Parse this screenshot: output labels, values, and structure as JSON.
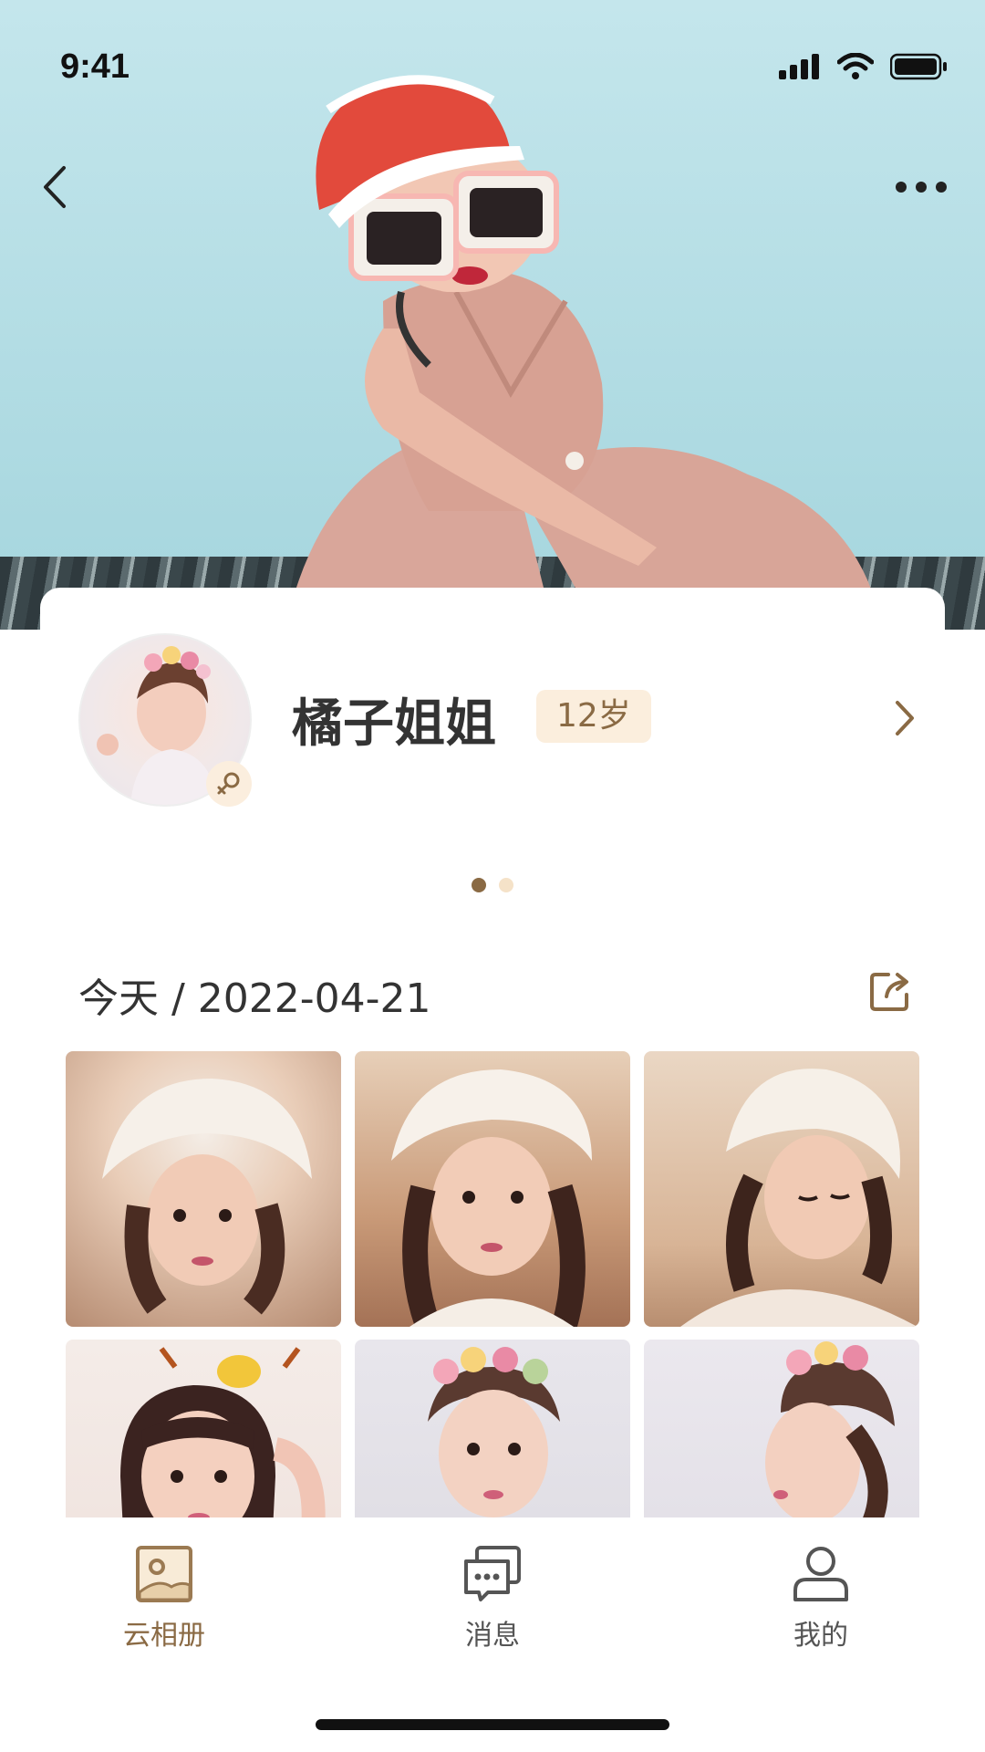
{
  "status_bar": {
    "time": "9:41"
  },
  "profile": {
    "name": "橘子姐姐",
    "age": "12岁",
    "gender_icon": "female-icon"
  },
  "carousel": {
    "pages": 2,
    "active": 1
  },
  "date_header": {
    "label": "今天 / 2022-04-21"
  },
  "tabs": [
    {
      "label": "云相册",
      "icon": "photo-album-icon",
      "active": true
    },
    {
      "label": "消息",
      "icon": "message-icon",
      "active": false
    },
    {
      "label": "我的",
      "icon": "profile-icon",
      "active": false
    }
  ],
  "colors": {
    "accent": "#8a6a44",
    "badge_bg": "#fbeedd",
    "dot_inactive": "#f5e2c8"
  }
}
